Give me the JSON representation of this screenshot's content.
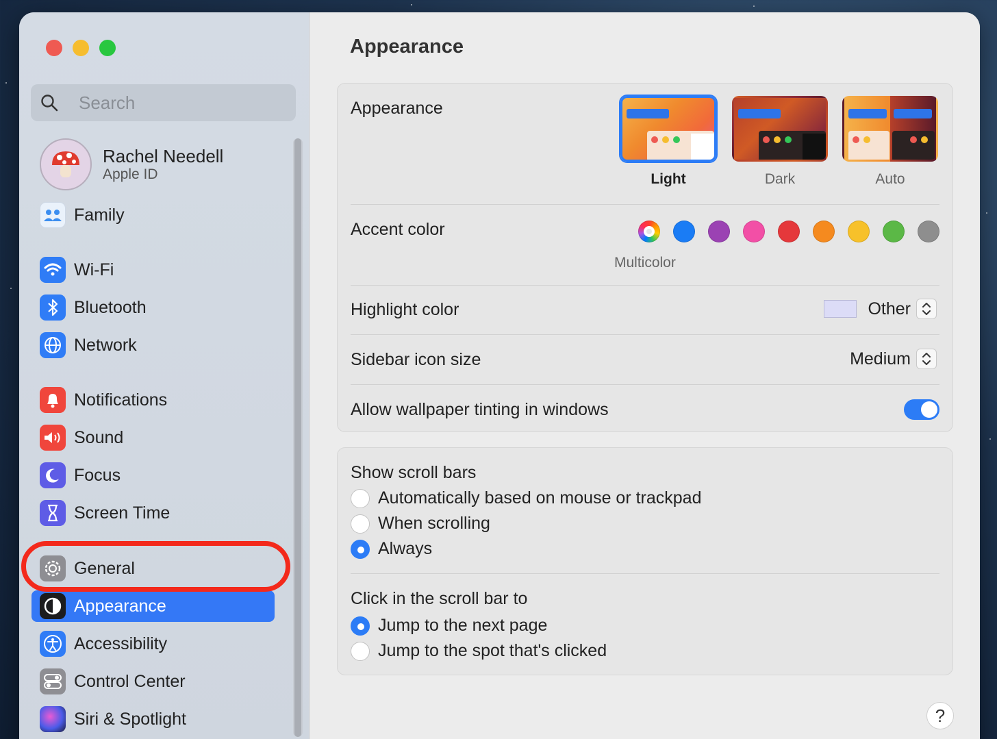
{
  "sidebar": {
    "search_placeholder": "Search",
    "profile": {
      "name": "Rachel Needell",
      "subtitle": "Apple ID"
    },
    "items": {
      "family": "Family",
      "wifi": "Wi-Fi",
      "bluetooth": "Bluetooth",
      "network": "Network",
      "notifications": "Notifications",
      "sound": "Sound",
      "focus": "Focus",
      "screen_time": "Screen Time",
      "general": "General",
      "appearance": "Appearance",
      "accessibility": "Accessibility",
      "control_center": "Control Center",
      "siri_spotlight": "Siri & Spotlight"
    },
    "selected_item": "Appearance"
  },
  "main": {
    "title": "Appearance",
    "appearance_row": {
      "label": "Appearance",
      "options": [
        "Light",
        "Dark",
        "Auto"
      ],
      "selected": "Light"
    },
    "accent_row": {
      "label": "Accent color",
      "colors": [
        "multicolor",
        "#1a7cf5",
        "#9b42b3",
        "#f24fa6",
        "#e5383b",
        "#f58a1f",
        "#f7c12a",
        "#5bb846",
        "#8e8e8e"
      ],
      "selected_label": "Multicolor"
    },
    "highlight_row": {
      "label": "Highlight color",
      "value": "Other",
      "swatch": "#dcdcf7"
    },
    "sidebar_icon_row": {
      "label": "Sidebar icon size",
      "value": "Medium"
    },
    "tinting_row": {
      "label": "Allow wallpaper tinting in windows",
      "enabled": true
    },
    "scroll_bars": {
      "label": "Show scroll bars",
      "options": [
        "Automatically based on mouse or trackpad",
        "When scrolling",
        "Always"
      ],
      "selected": "Always"
    },
    "click_scroll": {
      "label": "Click in the scroll bar to",
      "options": [
        "Jump to the next page",
        "Jump to the spot that's clicked"
      ],
      "selected": "Jump to the next page"
    },
    "help_label": "?"
  },
  "colors": {
    "accent": "#2c7cf6",
    "highlight_ring": "#f3291b"
  }
}
